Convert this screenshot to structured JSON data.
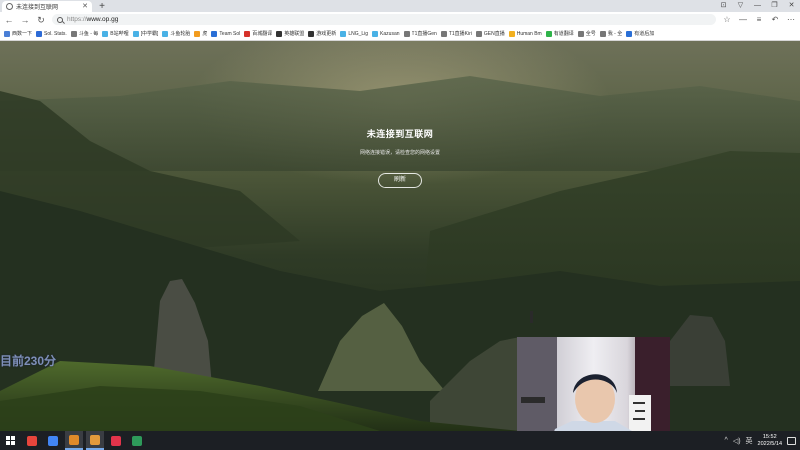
{
  "browser": {
    "tab": {
      "title": "未连接到互联网",
      "icon": "globe-icon"
    },
    "new_tab_label": "+",
    "window_controls": [
      "⊡",
      "▽",
      "—",
      "❐",
      "✕"
    ],
    "url": {
      "scheme": "https://",
      "host": "www.op.gg"
    },
    "toolbar_icons": [
      "star-icon",
      "minus-icon",
      "menu-icon",
      "undo-icon",
      "more-icon"
    ]
  },
  "bookmarks": [
    {
      "label": "西数一下",
      "color": "#4a7fd6"
    },
    {
      "label": "Sol. Stats.",
      "color": "#2d6bd6"
    },
    {
      "label": "斗鱼 - 每",
      "color": "#777777"
    },
    {
      "label": "B站哔哩",
      "color": "#4ab2e6"
    },
    {
      "label": "[中学霸]",
      "color": "#4ab2e6"
    },
    {
      "label": "斗鱼轮胎",
      "color": "#4ab2e6"
    },
    {
      "label": "虎",
      "color": "#f29c1f"
    },
    {
      "label": "Team Sol",
      "color": "#2a6fd6"
    },
    {
      "label": "百城翻译",
      "color": "#d6322a"
    },
    {
      "label": "英雄联盟",
      "color": "#333333"
    },
    {
      "label": "游戏更新",
      "color": "#333333"
    },
    {
      "label": "LNG_Lig",
      "color": "#4ab2e6"
    },
    {
      "label": "Kazusan",
      "color": "#4ab2e6"
    },
    {
      "label": "T1直播Gen",
      "color": "#777777"
    },
    {
      "label": "T1直播Kiri",
      "color": "#777777"
    },
    {
      "label": "GEN直播",
      "color": "#777777"
    },
    {
      "label": "Human Bm",
      "color": "#f2b01f"
    },
    {
      "label": "有道翻译",
      "color": "#2fb34a"
    },
    {
      "label": "全号",
      "color": "#777777"
    },
    {
      "label": "我 - 全",
      "color": "#777777"
    },
    {
      "label": "有道后加",
      "color": "#2a6fd6"
    }
  ],
  "offline_page": {
    "title": "未连接到互联网",
    "description": "网络连接错误，请检查您的网络设置",
    "refresh_label": "刷新"
  },
  "stream_overlay": {
    "score_text": "目前230分"
  },
  "taskbar": {
    "apps": [
      {
        "name": "chrome-icon",
        "color": "#e8453c",
        "active": false
      },
      {
        "name": "chrome-alt-icon",
        "color": "#4285f4",
        "active": false
      },
      {
        "name": "streaming-app-icon",
        "color": "#e08a2a",
        "active": true
      },
      {
        "name": "box-app-icon",
        "color": "#e39a3c",
        "active": true
      },
      {
        "name": "red-app-icon",
        "color": "#e2344b",
        "active": false
      },
      {
        "name": "green-app-icon",
        "color": "#2e9a5a",
        "active": false
      }
    ],
    "tray": {
      "icons": [
        "^",
        "◁)",
        "英"
      ],
      "time": "15:52",
      "date": "2022/5/14"
    }
  }
}
